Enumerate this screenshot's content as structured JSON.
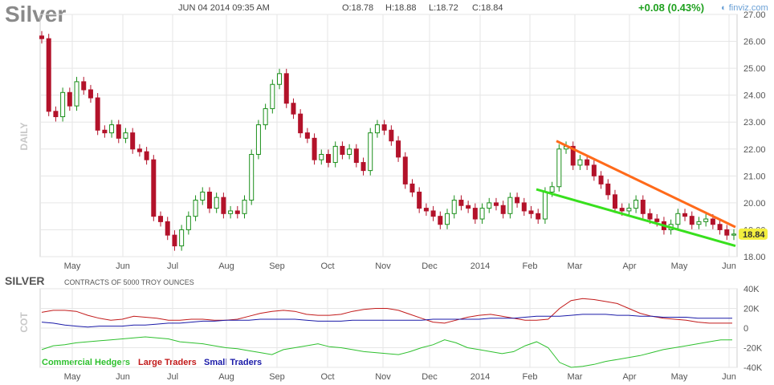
{
  "header": {
    "symbol": "Silver",
    "datetime": "JUN 04 2014 09:35 AM",
    "open": "O:18.78",
    "high": "H:18.88",
    "low": "L:18.72",
    "close": "C:18.84",
    "change": "+0.08 (0.43%)",
    "logo": "finviz.com"
  },
  "colors": {
    "up": "#1a8f1a",
    "down": "#b3122a",
    "trend_up": "#ff6a1a",
    "trend_low": "#38e01e",
    "grid": "#e6e6e6",
    "price_badge": "#f2ee3e",
    "commercial": "#2ec02e",
    "large": "#c21a1a",
    "small": "#1a1aa8"
  },
  "chart_data": [
    {
      "type": "candlestick",
      "period_label": "DAILY",
      "x_ticks": [
        "May",
        "Jun",
        "Jul",
        "Aug",
        "Sep",
        "Oct",
        "Nov",
        "Dec",
        "2014",
        "Feb",
        "Mar",
        "Apr",
        "May",
        "Jun"
      ],
      "y_ticks": [
        "18.00",
        "19.00",
        "20.00",
        "21.00",
        "22.00",
        "23.00",
        "24.00",
        "25.00",
        "26.00",
        "27.00"
      ],
      "ylim": [
        18,
        27
      ],
      "last_price": "18.84",
      "series": [
        {
          "values": [
            26.1,
            23.4,
            23.2,
            24.1,
            23.6,
            24.5,
            24.2,
            23.9,
            22.7,
            22.6,
            22.9,
            22.4,
            22.6,
            22.0,
            21.9,
            21.6,
            19.5,
            19.3,
            18.8,
            18.4,
            19.0,
            19.5,
            20.1,
            20.4,
            19.8,
            20.2,
            19.6,
            19.7,
            19.6,
            20.1,
            21.8,
            22.9,
            23.5,
            24.4,
            24.8,
            23.7,
            23.3,
            22.6,
            22.4,
            21.6,
            21.8,
            21.5,
            22.1,
            21.8,
            22.0,
            21.5,
            21.2,
            22.6,
            22.9,
            22.7,
            22.3,
            21.7,
            20.7,
            20.4,
            19.8,
            19.7,
            19.5,
            19.2,
            19.6,
            20.1,
            19.9,
            19.8,
            19.4,
            19.8,
            20.0,
            19.9,
            19.6,
            20.2,
            20.0,
            19.7,
            19.6,
            19.4,
            20.4,
            20.6,
            22.0,
            22.1,
            21.4,
            21.6,
            21.4,
            21.0,
            20.7,
            20.3,
            19.8,
            19.7,
            19.8,
            20.1,
            19.6,
            19.4,
            19.3,
            19.0,
            19.2,
            19.6,
            19.5,
            19.2,
            19.3,
            19.4,
            19.2,
            19.0,
            18.8,
            18.84
          ]
        }
      ],
      "trendlines": [
        {
          "start": [
            "Feb",
            "22.3"
          ],
          "end": [
            "Jun",
            "19.1"
          ]
        },
        {
          "start": [
            "Feb",
            "20.5"
          ],
          "end": [
            "Jun",
            "18.4"
          ]
        }
      ]
    },
    {
      "type": "line",
      "title": "SILVER",
      "subtitle": "CONTRACTS OF 5000 TROY OUNCES",
      "period_label": "COT",
      "x_ticks": [
        "May",
        "Jun",
        "Jul",
        "Aug",
        "Sep",
        "Oct",
        "Nov",
        "Dec",
        "2014",
        "Feb",
        "Mar",
        "Apr",
        "May",
        "Jun"
      ],
      "y_ticks": [
        "40K",
        "20K",
        "0",
        "-20K",
        "-40K"
      ],
      "ylim": [
        -40000,
        40000
      ],
      "series": [
        {
          "name": "Commercial Hedgers",
          "values": [
            -22000,
            -18000,
            -17000,
            -15000,
            -14000,
            -13000,
            -12000,
            -11000,
            -10000,
            -9000,
            -10000,
            -11000,
            -14000,
            -15000,
            -16000,
            -18000,
            -20000,
            -21000,
            -23000,
            -25000,
            -27000,
            -22000,
            -20000,
            -18000,
            -16000,
            -19000,
            -20000,
            -22000,
            -24000,
            -25000,
            -26000,
            -27000,
            -24000,
            -20000,
            -17000,
            -12000,
            -15000,
            -20000,
            -22000,
            -24000,
            -26000,
            -24000,
            -18000,
            -14000,
            -20000,
            -35000,
            -40000,
            -39000,
            -37000,
            -34000,
            -32000,
            -30000,
            -28000,
            -25000,
            -22000,
            -20000,
            -18000,
            -16000,
            -14000,
            -12000,
            -12000
          ]
        },
        {
          "name": "Large Traders",
          "values": [
            16000,
            18000,
            18000,
            17000,
            13000,
            10000,
            8000,
            9000,
            12000,
            11000,
            10000,
            8000,
            8000,
            9000,
            9000,
            8000,
            8000,
            9000,
            12000,
            15000,
            17000,
            18000,
            17000,
            14000,
            13000,
            13000,
            14000,
            17000,
            19000,
            20000,
            20000,
            18000,
            14000,
            10000,
            6000,
            5000,
            8000,
            11000,
            13000,
            14000,
            12000,
            10000,
            8000,
            8000,
            9000,
            20000,
            28000,
            30000,
            29000,
            27000,
            25000,
            20000,
            15000,
            12000,
            10000,
            9000,
            8000,
            6000,
            5000,
            5000,
            5000
          ]
        },
        {
          "name": "Small Traders",
          "values": [
            6000,
            5000,
            3000,
            2000,
            1000,
            2000,
            2000,
            2000,
            3000,
            3000,
            4000,
            5000,
            5000,
            6000,
            7000,
            7000,
            8000,
            8000,
            8000,
            9000,
            9000,
            9000,
            9000,
            8000,
            7000,
            7000,
            7000,
            8000,
            8000,
            8000,
            8000,
            8000,
            8000,
            8000,
            9000,
            9000,
            9000,
            9000,
            9000,
            10000,
            10000,
            10000,
            11000,
            12000,
            12000,
            12000,
            13000,
            14000,
            14000,
            14000,
            13000,
            13000,
            12000,
            12000,
            11000,
            11000,
            11000,
            10000,
            10000,
            10000,
            10000
          ]
        }
      ]
    }
  ]
}
